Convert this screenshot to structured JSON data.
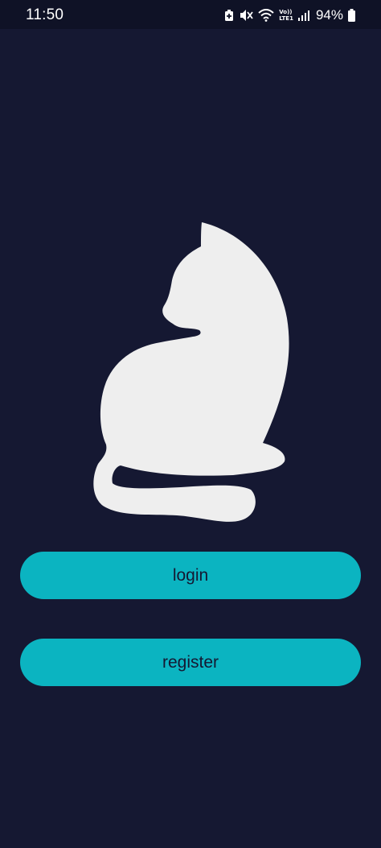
{
  "status_bar": {
    "time": "11:50",
    "network_label_top": "Vo))",
    "network_label_bottom": "LTE1",
    "battery_percent": "94%",
    "icons": [
      "battery-saver-icon",
      "mute-icon",
      "wifi-icon",
      "volte-icon",
      "signal-icon",
      "battery-icon"
    ]
  },
  "logo": {
    "icon": "cat-silhouette",
    "color": "#eeeeee"
  },
  "actions": {
    "login_label": "login",
    "register_label": "register"
  },
  "colors": {
    "background": "#151832",
    "accent": "#0bb4c1",
    "button_text": "#151832"
  }
}
